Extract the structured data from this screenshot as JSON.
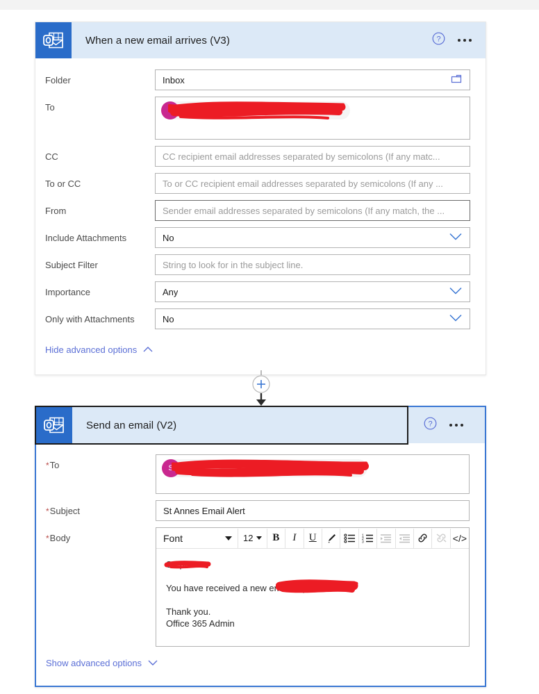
{
  "trigger_card": {
    "icon_name": "outlook-icon",
    "title": "When a new email arrives (V3)",
    "help_label": "?",
    "more_label": "...",
    "fields": [
      {
        "label": "Folder",
        "value": "Inbox",
        "kind": "picker",
        "icon": "folder-icon"
      },
      {
        "label": "To",
        "kind": "recipient",
        "pill_redacted": true,
        "remove_label": "✕"
      },
      {
        "label": "CC",
        "placeholder": "CC recipient email addresses separated by semicolons (If any matc...",
        "kind": "text"
      },
      {
        "label": "To or CC",
        "placeholder": "To or CC recipient email addresses separated by semicolons (If any ...",
        "kind": "text"
      },
      {
        "label": "From",
        "placeholder": "Sender email addresses separated by semicolons (If any match, the ...",
        "kind": "text"
      },
      {
        "label": "Include Attachments",
        "value": "No",
        "kind": "select"
      },
      {
        "label": "Subject Filter",
        "placeholder": "String to look for in the subject line.",
        "kind": "text"
      },
      {
        "label": "Importance",
        "value": "Any",
        "kind": "select"
      },
      {
        "label": "Only with Attachments",
        "value": "No",
        "kind": "select"
      }
    ],
    "advanced_link": "Hide advanced options",
    "advanced_chevron": "chevron-up-icon"
  },
  "connector": {
    "add_label": "+",
    "icon_name": "add-step-button"
  },
  "action_card": {
    "icon_name": "outlook-icon",
    "title": "Send an email (V2)",
    "help_label": "?",
    "more_label": "...",
    "to": {
      "label": "To",
      "required": "*",
      "avatar_initial": "S",
      "remove_label": ""
    },
    "subject": {
      "label": "Subject",
      "required": "*",
      "value": "St Annes Email Alert"
    },
    "body": {
      "label": "Body",
      "required": "*",
      "toolbar": {
        "font_label": "Font",
        "size_label": "12",
        "bold_label": "B",
        "italic_label": "I",
        "underline_label": "U",
        "highlight_label": "highlight-pen-icon",
        "bullet_list_label": "bulleted-list-icon",
        "numbered_list_label": "numbered-list-icon",
        "indent_label": "indent-icon",
        "outdent_label": "outdent-icon",
        "link_label": "link-icon",
        "unlink_label": "unlink-icon",
        "code_label": "</>"
      },
      "lines": {
        "greeting": "Stephen",
        "sentence": "You have received a new email in you",
        "thanks": "Thank you.",
        "signature": "Office 365 Admin"
      }
    },
    "advanced_link": "Show advanced options",
    "advanced_chevron": "chevron-down-icon"
  },
  "colors": {
    "header_blue": "#dce9f7",
    "icon_blue": "#2a6cc9",
    "selected_border": "#3a77d3",
    "link_blue": "#5b6fd6",
    "avatar_pink": "#c9288f",
    "redaction_red": "#ec1c24"
  }
}
